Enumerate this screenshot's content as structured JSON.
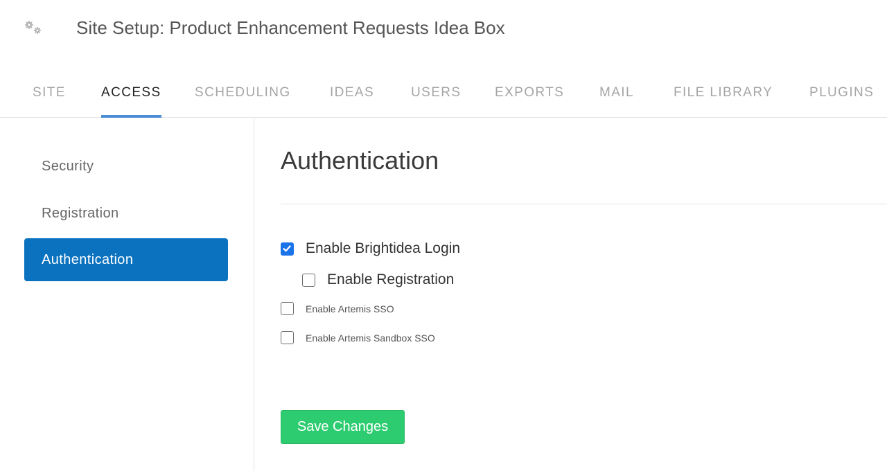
{
  "header": {
    "title": "Site Setup: Product Enhancement Requests Idea Box",
    "icon": "gears-icon"
  },
  "tabs": [
    {
      "label": "SITE",
      "active": false
    },
    {
      "label": "ACCESS",
      "active": true
    },
    {
      "label": "SCHEDULING",
      "active": false
    },
    {
      "label": "IDEAS",
      "active": false
    },
    {
      "label": "USERS",
      "active": false
    },
    {
      "label": "EXPORTS",
      "active": false
    },
    {
      "label": "MAIL",
      "active": false
    },
    {
      "label": "FILE LIBRARY",
      "active": false
    },
    {
      "label": "PLUGINS",
      "active": false
    }
  ],
  "sidebar": {
    "items": [
      {
        "label": "Security",
        "active": false
      },
      {
        "label": "Registration",
        "active": false
      },
      {
        "label": "Authentication",
        "active": true
      }
    ]
  },
  "main": {
    "title": "Authentication",
    "options": [
      {
        "label": "Enable Brightidea Login",
        "checked": true
      },
      {
        "label": "Enable Registration",
        "checked": false
      },
      {
        "label": "Enable Artemis SSO",
        "checked": false
      },
      {
        "label": "Enable Artemis Sandbox SSO",
        "checked": false
      }
    ],
    "save_label": "Save Changes"
  },
  "colors": {
    "active_tab_underline": "#4a8fd6",
    "sidebar_active_bg": "#0a72bf",
    "save_button_bg": "#2ecc71",
    "checkbox_checked": "#1a73e8"
  }
}
